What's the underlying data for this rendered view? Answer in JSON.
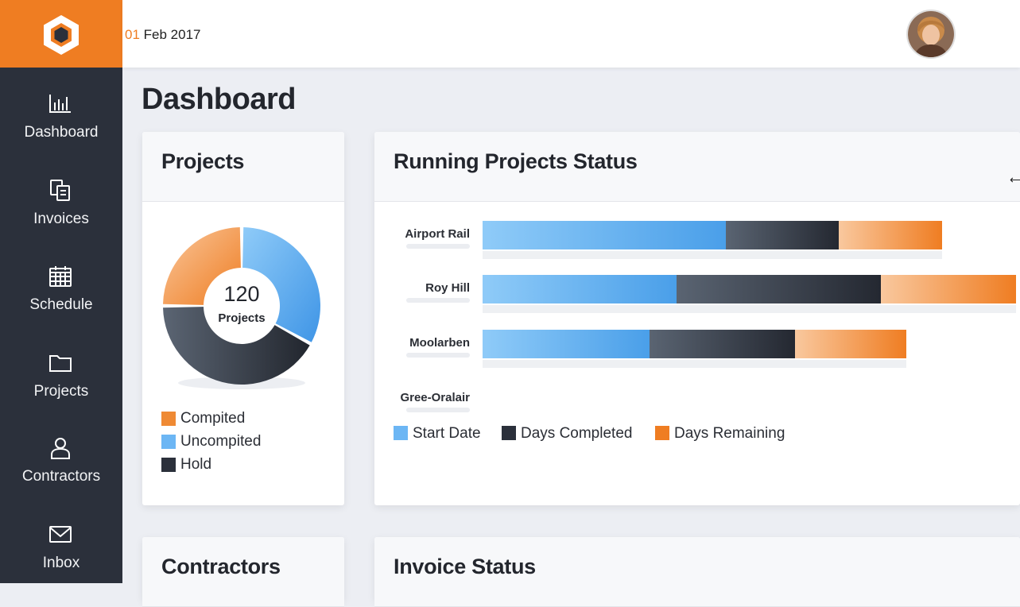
{
  "app": {
    "accent": "#ef7d22",
    "sidebar_bg": "#2b303b"
  },
  "header": {
    "date_day": "01",
    "date_rest": " Feb 2017"
  },
  "sidebar": {
    "items": [
      {
        "label": "Dashboard",
        "icon": "bar-chart-icon"
      },
      {
        "label": "Invoices",
        "icon": "documents-icon"
      },
      {
        "label": "Schedule",
        "icon": "calendar-icon"
      },
      {
        "label": "Projects",
        "icon": "folder-icon"
      },
      {
        "label": "Contractors",
        "icon": "user-icon"
      },
      {
        "label": "Inbox",
        "icon": "envelope-icon"
      }
    ]
  },
  "page": {
    "title": "Dashboard"
  },
  "projects_card": {
    "title": "Projects",
    "total": "120",
    "total_label": "Projects",
    "legend": [
      {
        "label": "Compited",
        "color": "#ef8a34"
      },
      {
        "label": "Uncompited",
        "color": "#6cb6f4"
      },
      {
        "label": "Hold",
        "color": "#2b303b"
      }
    ]
  },
  "running_card": {
    "title": "Running Projects Status",
    "legend": [
      {
        "label": "Start Date",
        "color": "#6cb6f4"
      },
      {
        "label": "Days Completed",
        "color": "#2b303b"
      },
      {
        "label": "Days Remaining",
        "color": "#ef7d22"
      }
    ]
  },
  "contractors_card": {
    "title": "Contractors"
  },
  "invoice_card": {
    "title": "Invoice Status"
  },
  "chart_data": [
    {
      "type": "pie",
      "title": "Projects",
      "categories": [
        "Compited",
        "Uncompited",
        "Hold"
      ],
      "values": [
        25,
        33,
        42
      ]
    },
    {
      "type": "bar",
      "orientation": "horizontal",
      "stacked": true,
      "title": "Running Projects Status",
      "categories": [
        "Airport Rail",
        "Roy Hill",
        "Moolarben",
        "Gree-Oralair"
      ],
      "series": [
        {
          "name": "Start Date",
          "values": [
            306,
            244,
            210,
            0
          ]
        },
        {
          "name": "Days Completed",
          "values": [
            142,
            257,
            183,
            0
          ]
        },
        {
          "name": "Days Remaining",
          "values": [
            130,
            170,
            140,
            0
          ]
        }
      ]
    }
  ]
}
